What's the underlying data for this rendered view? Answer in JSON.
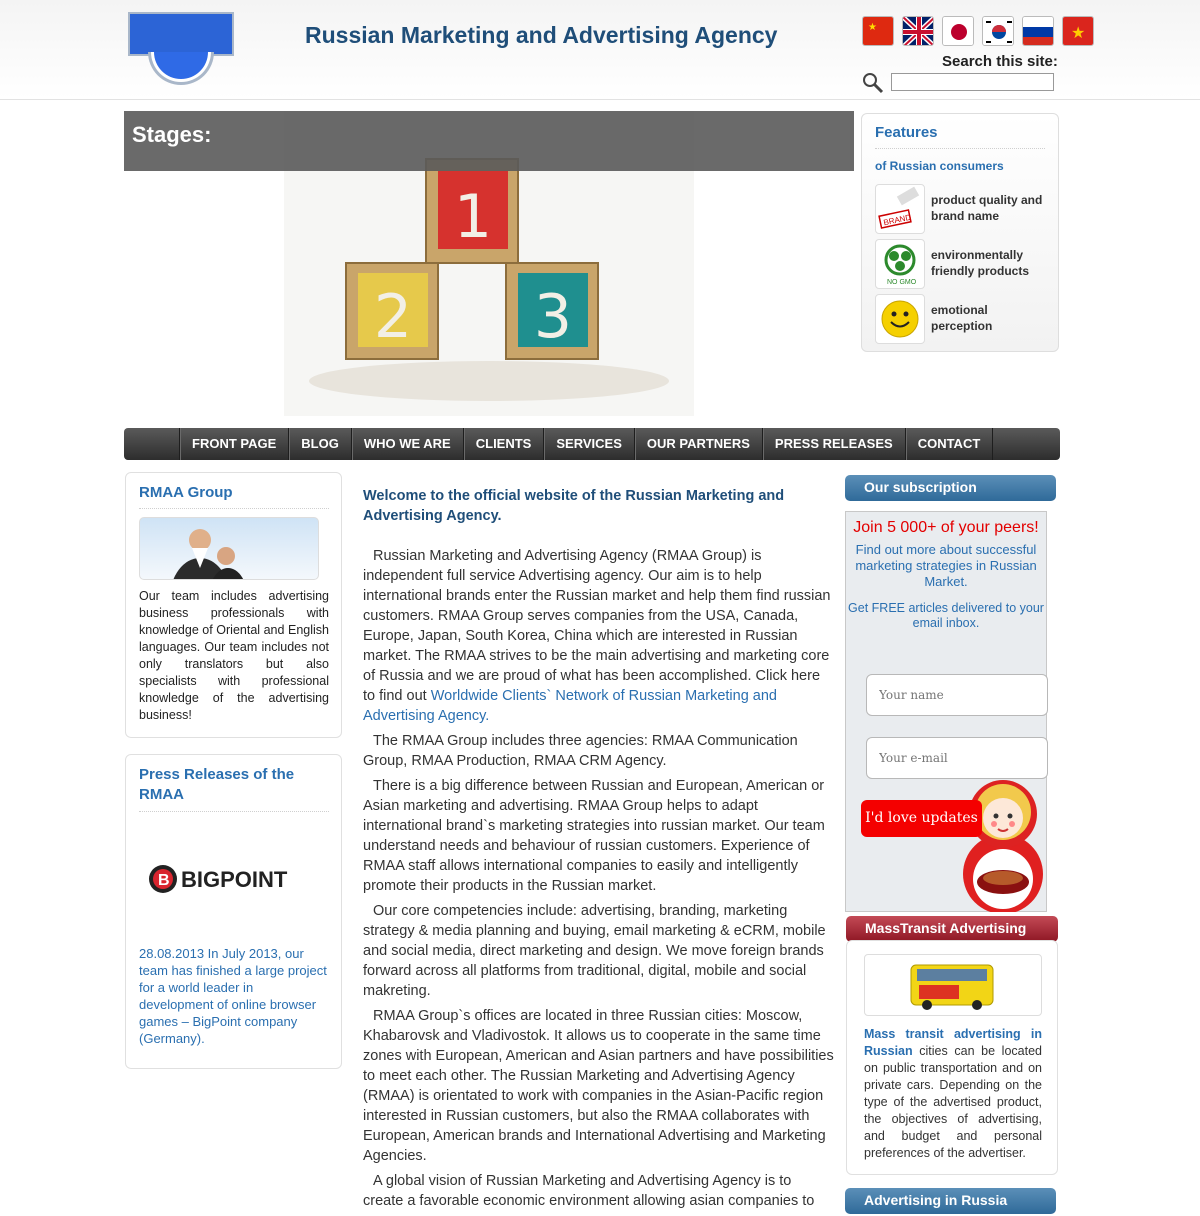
{
  "header": {
    "site_title": "Russian Marketing and Advertising Agency",
    "search_label": "Search this site:",
    "flags": [
      "china-flag-icon",
      "uk-flag-icon",
      "japan-flag-icon",
      "korea-flag-icon",
      "russia-flag-icon",
      "vietnam-flag-icon"
    ]
  },
  "banner": {
    "title": "Stages:"
  },
  "features": {
    "title": "Features",
    "subtitle": "of Russian consumers",
    "items": [
      {
        "label": "product quality and brand name",
        "icon": "brand-icon"
      },
      {
        "label": "environmentally friendly products",
        "icon": "no-gmo-icon"
      },
      {
        "label": "emotional perception",
        "icon": "smiley-icon"
      }
    ]
  },
  "nav": [
    "FRONT PAGE",
    "BLOG",
    "WHO WE ARE",
    "CLIENTS",
    "SERVICES",
    "OUR PARTNERS",
    "PRESS RELEASES",
    "CONTACT"
  ],
  "left": {
    "rmaa_title": "RMAA Group",
    "rmaa_text": "Our team includes advertising business professionals with knowledge of Oriental and English languages. Our team includes not only translators but also specialists with professional knowledge of the advertising business!",
    "press_title": "Press Releases of the RMAA",
    "press_logo_text": "BIGPOINT",
    "press_text": "28.08.2013 In July 2013, our team has finished a large project for a world leader in development of online browser games – BigPoint company (Germany)."
  },
  "main": {
    "welcome": "Welcome to the official website of the Russian Marketing and Advertising Agency.",
    "p1": "Russian Marketing and Advertising Agency (RMAA Group) is independent full service Advertising agency. Our aim is to help international brands enter the Russian market and help them find russian customers. RMAA Group serves companies from the USA, Canada, Europe, Japan, South Korea, China which are interested in Russian market. The RMAA strives to be the main advertising and marketing core of Russia and we are proud of what has been accomplished. Click here to find out ",
    "p1_link": "Worldwide Clients` Network of Russian Marketing and Advertising Agency",
    "p1_end": ".",
    "p2": "The RMAA Group includes three agencies: RMAA Communication Group, RMAA Production, RMAA CRM Agency.",
    "p3": "There is a big difference between Russian and European, American or Asian marketing and advertising. RMAA Group helps to adapt international brand`s marketing strategies into russian market. Our team understand needs and behaviour of russian customers. Experience of RMAA staff allows international companies to easily and intelligently promote their products in the Russian market.",
    "p4": "Our core competencies include: advertising, branding, marketing strategy & media planning and buying, email marketing & eCRM, mobile and social media, direct marketing and design. We move foreign brands forward across all platforms from traditional, digital, mobile and social makreting.",
    "p5": "RMAA Group`s offices are located in three Russian cities: Moscow, Khabarovsk and Vladivostok. It allows us to cooperate in the same time zones with European, American and Asian partners and have possibilities to meet each other. The Russian Marketing and Advertising Agency (RMAA) is orientated to work with companies in the Asian-Pacific region interested in Russian customers, but also the RMAA collaborates with European, American brands and International Advertising and Marketing Agencies.",
    "p6": "A global vision of Russian Marketing and Advertising Agency is to create a favorable economic environment allowing asian companies to"
  },
  "subscription": {
    "heading": "Our subscription",
    "join": "Join 5 000+ of your peers!",
    "findout": "Find out more about successful marketing strategies in Russian Market.",
    "getfree": "Get FREE articles delivered to your email inbox.",
    "name_placeholder": "Your name",
    "email_placeholder": "Your e-mail",
    "button": "I'd love updates"
  },
  "masstransit": {
    "heading": "MassTransit Advertising",
    "bold": "Mass transit advertising in Russian",
    "text": " cities can be located on public transportation and on private cars. Depending on the type of the advertised product, the objectives of advertising, and budget and personal preferences of the advertiser."
  },
  "advrus": {
    "heading": "Advertising in Russia"
  }
}
